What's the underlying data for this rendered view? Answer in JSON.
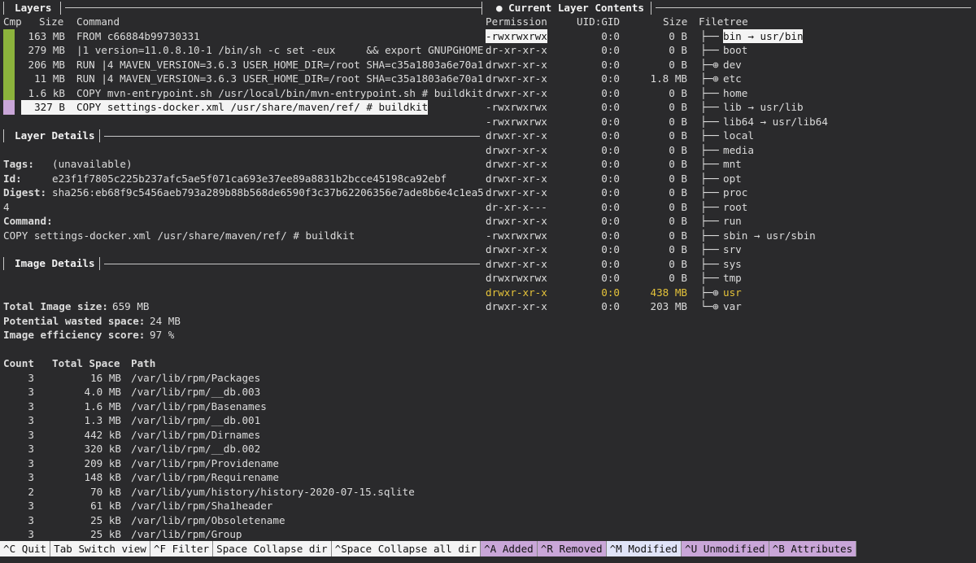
{
  "colors": {
    "cmp_full": "#8cb33c",
    "cmp_partial": "#c9a6d8",
    "modified": "#e5c33a",
    "selected_bg": "#f4f4f4"
  },
  "layers_panel": {
    "title": "Layers",
    "headers": [
      "Cmp",
      "Size",
      "Command"
    ],
    "rows": [
      {
        "size": "163 MB",
        "command": "FROM c66884b99730331"
      },
      {
        "size": "279 MB",
        "command": "|1 version=11.0.8.10-1 /bin/sh -c set -eux     && export GNUPGHOME"
      },
      {
        "size": "206 MB",
        "command": "RUN |4 MAVEN_VERSION=3.6.3 USER_HOME_DIR=/root SHA=c35a1803a6e70a1"
      },
      {
        "size": "11 MB",
        "command": "RUN |4 MAVEN_VERSION=3.6.3 USER_HOME_DIR=/root SHA=c35a1803a6e70a1"
      },
      {
        "size": "1.6 kB",
        "command": "COPY mvn-entrypoint.sh /usr/local/bin/mvn-entrypoint.sh # buildkit"
      },
      {
        "size": "327 B",
        "command": "COPY settings-docker.xml /usr/share/maven/ref/ # buildkit"
      }
    ]
  },
  "layer_details": {
    "title": "Layer Details",
    "tags_label": "Tags:",
    "tags": "(unavailable)",
    "id_label": "Id:",
    "id": "e23f1f7805c225b237afc5ae5f071ca693e37ee89a8831b2bcce45198ca92ebf",
    "digest_label": "Digest:",
    "digest": "sha256:eb68f9c5456aeb793a289b88b568de6590f3c37b62206356e7ade8b6e4c1ea5",
    "digest_wrap": "4",
    "command_label": "Command:",
    "command": "COPY settings-docker.xml /usr/share/maven/ref/ # buildkit"
  },
  "image_details": {
    "title": "Image Details",
    "total_size_label": "Total Image size:",
    "total_size": "659 MB",
    "wasted_label": "Potential wasted space:",
    "wasted": "24 MB",
    "efficiency_label": "Image efficiency score:",
    "efficiency": "97 %",
    "table_headers": [
      "Count",
      "Total Space",
      "Path"
    ],
    "rows": [
      {
        "count": "3",
        "space": "16 MB",
        "path": "/var/lib/rpm/Packages"
      },
      {
        "count": "3",
        "space": "4.0 MB",
        "path": "/var/lib/rpm/__db.003"
      },
      {
        "count": "3",
        "space": "1.6 MB",
        "path": "/var/lib/rpm/Basenames"
      },
      {
        "count": "3",
        "space": "1.3 MB",
        "path": "/var/lib/rpm/__db.001"
      },
      {
        "count": "3",
        "space": "442 kB",
        "path": "/var/lib/rpm/Dirnames"
      },
      {
        "count": "3",
        "space": "320 kB",
        "path": "/var/lib/rpm/__db.002"
      },
      {
        "count": "3",
        "space": "209 kB",
        "path": "/var/lib/rpm/Providename"
      },
      {
        "count": "3",
        "space": "148 kB",
        "path": "/var/lib/rpm/Requirename"
      },
      {
        "count": "2",
        "space": "70 kB",
        "path": "/var/lib/yum/history/history-2020-07-15.sqlite"
      },
      {
        "count": "3",
        "space": "61 kB",
        "path": "/var/lib/rpm/Sha1header"
      },
      {
        "count": "3",
        "space": "25 kB",
        "path": "/var/lib/rpm/Obsoletename"
      },
      {
        "count": "3",
        "space": "25 kB",
        "path": "/var/lib/rpm/Group"
      }
    ]
  },
  "contents_panel": {
    "title": "● Current Layer Contents",
    "headers": [
      "Permission",
      "UID:GID",
      "Size",
      "Filetree"
    ],
    "rows": [
      {
        "perm": "-rwxrwxrwx",
        "uid": "0:0",
        "size": "0 B",
        "tree": "├── ",
        "name": "bin → usr/bin"
      },
      {
        "perm": "dr-xr-xr-x",
        "uid": "0:0",
        "size": "0 B",
        "tree": "├── ",
        "name": "boot"
      },
      {
        "perm": "drwxr-xr-x",
        "uid": "0:0",
        "size": "0 B",
        "tree": "├─⊕ ",
        "name": "dev"
      },
      {
        "perm": "drwxr-xr-x",
        "uid": "0:0",
        "size": "1.8 MB",
        "tree": "├─⊕ ",
        "name": "etc"
      },
      {
        "perm": "drwxr-xr-x",
        "uid": "0:0",
        "size": "0 B",
        "tree": "├── ",
        "name": "home"
      },
      {
        "perm": "-rwxrwxrwx",
        "uid": "0:0",
        "size": "0 B",
        "tree": "├── ",
        "name": "lib → usr/lib"
      },
      {
        "perm": "-rwxrwxrwx",
        "uid": "0:0",
        "size": "0 B",
        "tree": "├── ",
        "name": "lib64 → usr/lib64"
      },
      {
        "perm": "drwxr-xr-x",
        "uid": "0:0",
        "size": "0 B",
        "tree": "├── ",
        "name": "local"
      },
      {
        "perm": "drwxr-xr-x",
        "uid": "0:0",
        "size": "0 B",
        "tree": "├── ",
        "name": "media"
      },
      {
        "perm": "drwxr-xr-x",
        "uid": "0:0",
        "size": "0 B",
        "tree": "├── ",
        "name": "mnt"
      },
      {
        "perm": "drwxr-xr-x",
        "uid": "0:0",
        "size": "0 B",
        "tree": "├── ",
        "name": "opt"
      },
      {
        "perm": "drwxr-xr-x",
        "uid": "0:0",
        "size": "0 B",
        "tree": "├── ",
        "name": "proc"
      },
      {
        "perm": "dr-xr-x---",
        "uid": "0:0",
        "size": "0 B",
        "tree": "├── ",
        "name": "root"
      },
      {
        "perm": "drwxr-xr-x",
        "uid": "0:0",
        "size": "0 B",
        "tree": "├── ",
        "name": "run"
      },
      {
        "perm": "-rwxrwxrwx",
        "uid": "0:0",
        "size": "0 B",
        "tree": "├── ",
        "name": "sbin → usr/sbin"
      },
      {
        "perm": "drwxr-xr-x",
        "uid": "0:0",
        "size": "0 B",
        "tree": "├── ",
        "name": "srv"
      },
      {
        "perm": "drwxr-xr-x",
        "uid": "0:0",
        "size": "0 B",
        "tree": "├── ",
        "name": "sys"
      },
      {
        "perm": "drwxrwxrwx",
        "uid": "0:0",
        "size": "0 B",
        "tree": "├── ",
        "name": "tmp"
      },
      {
        "perm": "drwxr-xr-x",
        "uid": "0:0",
        "size": "438 MB",
        "tree": "├─⊕ ",
        "name": "usr"
      },
      {
        "perm": "drwxr-xr-x",
        "uid": "0:0",
        "size": "203 MB",
        "tree": "└─⊕ ",
        "name": "var"
      }
    ]
  },
  "footer": [
    {
      "key": "^C",
      "label": "Quit"
    },
    {
      "key": "Tab",
      "label": "Switch view"
    },
    {
      "key": "^F",
      "label": "Filter"
    },
    {
      "key": "Space",
      "label": "Collapse dir"
    },
    {
      "key": "^Space",
      "label": "Collapse all dir"
    },
    {
      "key": "^A",
      "label": "Added"
    },
    {
      "key": "^R",
      "label": "Removed"
    },
    {
      "key": "^M",
      "label": "Modified"
    },
    {
      "key": "^U",
      "label": "Unmodified"
    },
    {
      "key": "^B",
      "label": "Attributes"
    }
  ]
}
